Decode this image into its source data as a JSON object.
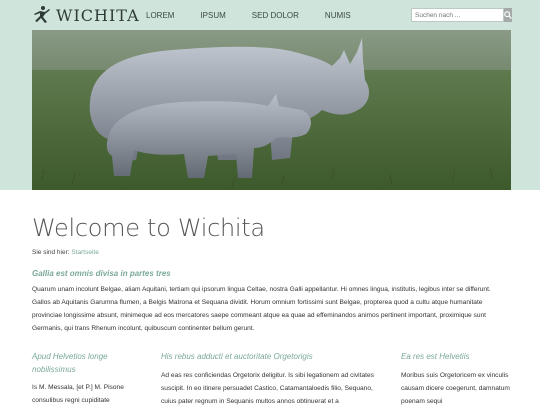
{
  "header": {
    "brand": "WICHITA",
    "nav": [
      "LOREM",
      "IPSUM",
      "SED DOLOR",
      "NUMIS"
    ],
    "search_placeholder": "Suchen nach ..."
  },
  "hero": {
    "image": "two black rhinoceroses on grassland"
  },
  "main": {
    "title": "Welcome to Wichita",
    "breadcrumb_prefix": "Sie sind hier:",
    "breadcrumb_link": "Startseite",
    "lead_heading": "Gallia est omnis divisa in partes tres",
    "lead_text": "Quarum unam incolunt Belgae, aliam Aquitani, tertiam qui ipsorum lingua Celtae, nostra Galli appellantur. Hi omnes lingua, institutis, legibus inter se differunt. Gallos ab Aquitanis Garumna flumen, a Belgis Matrona et Sequana dividit. Horum omnium fortissimi sunt Belgae, propterea quod a cultu atque humanitate provinciae longissime absunt, minimeque ad eos mercatores saepe commeant atque ea quae ad effeminandos animos pertinent important, proximique sunt Germanis, qui trans Rhenum incolunt, quibuscum continenter bellum gerunt."
  },
  "columns": [
    {
      "heading": "Apud Helvetios longe nobilissimus",
      "text": "Is M. Messala, [et P.] M. Pisone consulibus regni cupiditate"
    },
    {
      "heading": "His rebus adducti et auctoritate Orgetorigis",
      "text": "Ad eas res conficiendas Orgetorix deligitur. Is sibi legationem ad civitates suscipit. In eo itinere persuadet Castico, Catamantaloedis filio, Sequano, cuius pater regnum in Sequanis multos annos obtinuerat et a"
    },
    {
      "heading": "Ea res est Helvetiis",
      "text": "Moribus suis Orgetoricem ex vinculis causam dicere coegerunt, damnatum poenam sequi"
    }
  ],
  "colors": {
    "band": "#cfe4da",
    "accent": "#7aa89a"
  }
}
